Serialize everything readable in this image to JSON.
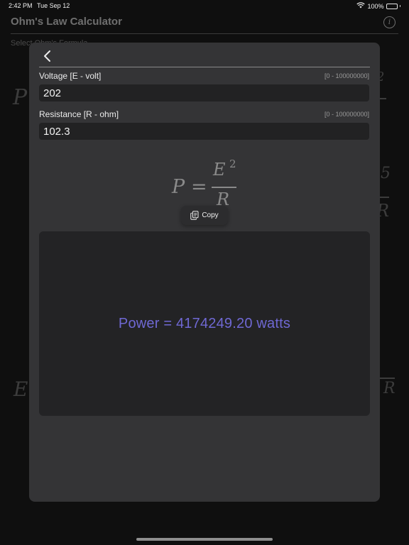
{
  "status_bar": {
    "time": "2:42 PM",
    "date": "Tue Sep 12",
    "battery_text": "100%",
    "battery_level": 1.0,
    "wifi_icon": "wifi-icon",
    "battery_icon": "battery-icon"
  },
  "background": {
    "app_title": "Ohm's Law Calculator",
    "subtitle": "Select Ohm's Formula",
    "info_icon": "info-icon",
    "info_glyph": "i",
    "formula_fragments": [
      "P",
      "2",
      "E",
      "5",
      "R",
      "R"
    ]
  },
  "sheet": {
    "back_icon": "chevron-left-icon",
    "fields": [
      {
        "label": "Voltage [E - volt]",
        "range": "[0 - 100000000]",
        "value": "202"
      },
      {
        "label": "Resistance [R - ohm]",
        "range": "[0 - 100000000]",
        "value": "102.3"
      }
    ],
    "formula": {
      "lhs": "P",
      "equals": "=",
      "numerator": "E",
      "exponent": "2",
      "denominator": "R"
    },
    "copy": {
      "label": "Copy",
      "icon": "copy-icon"
    },
    "result": "Power = 4174249.20 watts"
  },
  "colors": {
    "result_text": "#6f68d3",
    "sheet_bg": "#343436",
    "result_bg": "#232325",
    "input_bg": "#222223"
  }
}
